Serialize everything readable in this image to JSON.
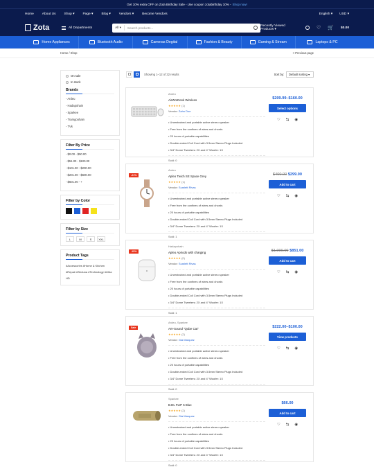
{
  "topbar": {
    "promo": "Get 10% extra OFF on Zota Birthday Sale - Use coupon zotabirthday 10% -",
    "link": "Shop now!"
  },
  "navbar": {
    "links": [
      "Home",
      "About Us",
      "Shop ▾",
      "Page ▾",
      "Blog ▾",
      "Vendors ▾",
      "Become Vendors"
    ],
    "language": "English ▾",
    "currency": "USD ▾"
  },
  "header": {
    "logo": "Zota",
    "all_departments": "All Departments",
    "search_category": "All ▾",
    "search_placeholder": "Search products...",
    "recently_viewed": "Recently Viewed Products ▾",
    "cart_total": "$0.00"
  },
  "categories": [
    "Home Appliances",
    "Bluetooth Audio",
    "Cameras Degital",
    "Fashion & Beauty",
    "Gaming & Stream",
    "Laptops & PC"
  ],
  "breadcrumb": {
    "path": "Home / Shop",
    "previous": "< Previous page"
  },
  "sidebar": {
    "stock": [
      "On sale",
      "In stock"
    ],
    "brands_title": "Brands",
    "brands": [
      "- Ardeu",
      "- Hadapohain",
      "- Sparkee",
      "- Tramgoohain",
      "- TVk"
    ],
    "price_title": "Filter By Price",
    "prices": [
      "- $0.00 - $50.00",
      "- $51.00 - $100.00",
      "- $101.00 - $200.00",
      "- $201.00 - $600.00",
      "- $601.00 - +"
    ],
    "color_title": "Filter by Color",
    "colors": [
      "#111111",
      "#1c5fd6",
      "#e02424",
      "#f5e21b"
    ],
    "size_title": "Filter by Size",
    "sizes": [
      "L",
      "M",
      "S",
      "XXL"
    ],
    "tags_title": "Product Tags",
    "tags": "#Accessories #Home & Kitchen #Repair #Seduna #Technology #Ultra HD"
  },
  "toolbar": {
    "showing": "Showing 1–12 of 32 results",
    "sort_label": "Sort by:",
    "sort_value": "Default sorting ▾"
  },
  "products": [
    {
      "badge": "",
      "brand": "Ardeu",
      "name": "AirWmDesk Wireless",
      "stars": "★★★★★",
      "count": "(1)",
      "vendor_label": "Vendor: ",
      "vendor": "Zahn Doe",
      "features": [
        "• Unrestrained and portable active stereo speaker",
        "• Free from the confines of wires and chords",
        "• 20 hours of portable capabilities",
        "• Double-ended Coil Cord with 3.5mm Stereo Plugs Included",
        "• 3/4” Dome Tweeters: 2X and 4” Woofer: 1X"
      ],
      "sold": "Sold: 0",
      "old_price": "",
      "price": "$209.99–$160.00",
      "button": "Select options",
      "icon": "keyboard"
    },
    {
      "badge": "-21%",
      "brand": "Ardeu",
      "name": "Apleo Twich SE Space Grey",
      "stars": "★★★★★",
      "count": "(1)",
      "vendor_label": "Vendor: ",
      "vendor": "Scarlett Rivas",
      "features": [
        "• Unrestrained and portable active stereo speaker",
        "• Free from the confines of wires and chords",
        "• 20 hours of portable capabilities",
        "• Double-ended Coil Cord with 3.5mm Stereo Plugs Included",
        "• 3/4” Dome Tweeters: 2X and 4” Woofer: 1X"
      ],
      "sold": "Sold: 1",
      "old_price": "$400.00",
      "price": "$299.00",
      "button": "Add to cart",
      "icon": "watch"
    },
    {
      "badge": "-15%",
      "brand": "Hadapohain",
      "name": "Apleo Apriods with charging",
      "stars": "★★★★★",
      "count": "(0)",
      "vendor_label": "Vendor: ",
      "vendor": "Scarlett Rivas",
      "features": [
        "• Unrestrained and portable active stereo speaker",
        "• Free from the confines of wires and chords",
        "• 20 hours of portable capabilities",
        "• Double-ended Coil Cord with 3.5mm Stereo Plugs Included",
        "• 3/4” Dome Tweeters: 2X and 4” Woofer: 1X"
      ],
      "sold": "Sold: 1",
      "old_price": "$1,000.00",
      "price": "$851.00",
      "button": "Add to cart",
      "icon": "airpods"
    },
    {
      "badge": "Sale",
      "brand": "Ardeu, Sparkee",
      "name": "Art+Sound “Qube Cat”",
      "stars": "★★★★★",
      "count": "(2)",
      "vendor_label": "Vendor: ",
      "vendor": "Gia Marquez",
      "features": [
        "• Unrestrained and portable active stereo speaker",
        "• Free from the confines of wires and chords",
        "• 20 hours of portable capabilities",
        "• Double-ended Coil Cord with 3.5mm Stereo Plugs Included",
        "• 3/4” Dome Tweeters: 2X and 4” Woofer: 1X"
      ],
      "sold": "Sold: 0",
      "old_price": "",
      "price": "$222.00–$100.00",
      "button": "View products",
      "icon": "catspeaker"
    },
    {
      "badge": "",
      "brand": "Sparkee",
      "name": "B.DL FLIP 5 Blue",
      "stars": "★★★★★",
      "count": "(2)",
      "vendor_label": "Vendor: ",
      "vendor": "Gia Marquez",
      "features": [
        "• Unrestrained and portable active stereo speaker",
        "• Free from the confines of wires and chords",
        "• 20 hours of portable capabilities",
        "• Double-ended Coil Cord with 3.5mm Stereo Plugs Included",
        "• 3/4” Dome Tweeters: 2X and 4” Woofer: 1X"
      ],
      "sold": "Sold: 0",
      "old_price": "",
      "price": "$66.00",
      "button": "Add to cart",
      "icon": "flip"
    }
  ]
}
